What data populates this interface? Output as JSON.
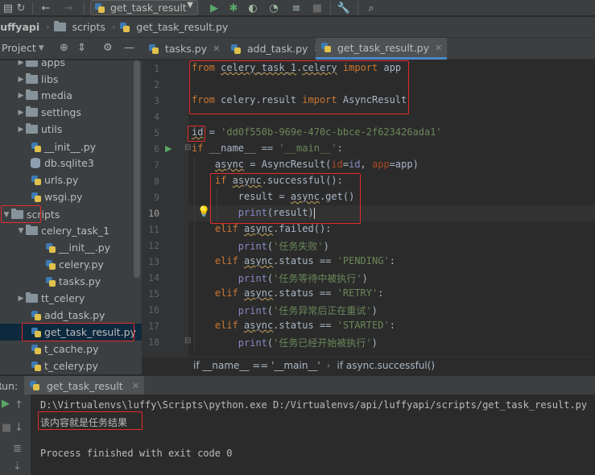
{
  "toolbar": {
    "config_name": "get_task_result"
  },
  "breadcrumb": {
    "project": "luffyapi",
    "folder": "scripts",
    "file": "get_task_result.py"
  },
  "project_panel": {
    "title": "Project",
    "items": [
      {
        "label": "apps",
        "type": "folder"
      },
      {
        "label": "libs",
        "type": "folder"
      },
      {
        "label": "media",
        "type": "folder"
      },
      {
        "label": "settings",
        "type": "folder"
      },
      {
        "label": "utils",
        "type": "folder"
      },
      {
        "label": "__init__.py",
        "type": "py"
      },
      {
        "label": "db.sqlite3",
        "type": "db"
      },
      {
        "label": "urls.py",
        "type": "py"
      },
      {
        "label": "wsgi.py",
        "type": "py"
      },
      {
        "label": "scripts",
        "type": "folder"
      },
      {
        "label": "celery_task_1",
        "type": "folder"
      },
      {
        "label": "__init__.py",
        "type": "py"
      },
      {
        "label": "celery.py",
        "type": "py"
      },
      {
        "label": "tasks.py",
        "type": "py"
      },
      {
        "label": "tt_celery",
        "type": "folder"
      },
      {
        "label": "add_task.py",
        "type": "py"
      },
      {
        "label": "get_task_result.py",
        "type": "py"
      },
      {
        "label": "t_cache.py",
        "type": "py"
      },
      {
        "label": "t_celery.py",
        "type": "py"
      }
    ]
  },
  "editor_tabs": [
    {
      "label": "tasks.py"
    },
    {
      "label": "add_task.py"
    },
    {
      "label": "get_task_result.py"
    }
  ],
  "code": {
    "line_numbers": [
      "1",
      "2",
      "3",
      "4",
      "5",
      "6",
      "7",
      "8",
      "9",
      "10",
      "11",
      "12",
      "13",
      "14",
      "15",
      "16",
      "17",
      "18"
    ],
    "id_value": "'dd0f550b-969e-470c-bbce-2f623426ada1'",
    "msg_failed": "'任务失败'",
    "msg_pending": "'任务等待中被执行'",
    "msg_retry": "'任务异常后正在重试'",
    "msg_started": "'任务已经开始被执行'",
    "status_pending": "'PENDING'",
    "status_retry": "'RETRY'",
    "status_started": "'STARTED'"
  },
  "editor_breadcrumb": {
    "item1": "if __name__ == '__main__'",
    "item2": "if async.successful()"
  },
  "run_panel": {
    "label": "Run:",
    "tab": "get_task_result",
    "command": "D:\\Virtualenvs\\luffy\\Scripts\\python.exe D:/Virtualenvs/api/luffyapi/scripts/get_task_result.py",
    "result": "该内容就是任务结果",
    "exit": "Process finished with exit code 0"
  }
}
